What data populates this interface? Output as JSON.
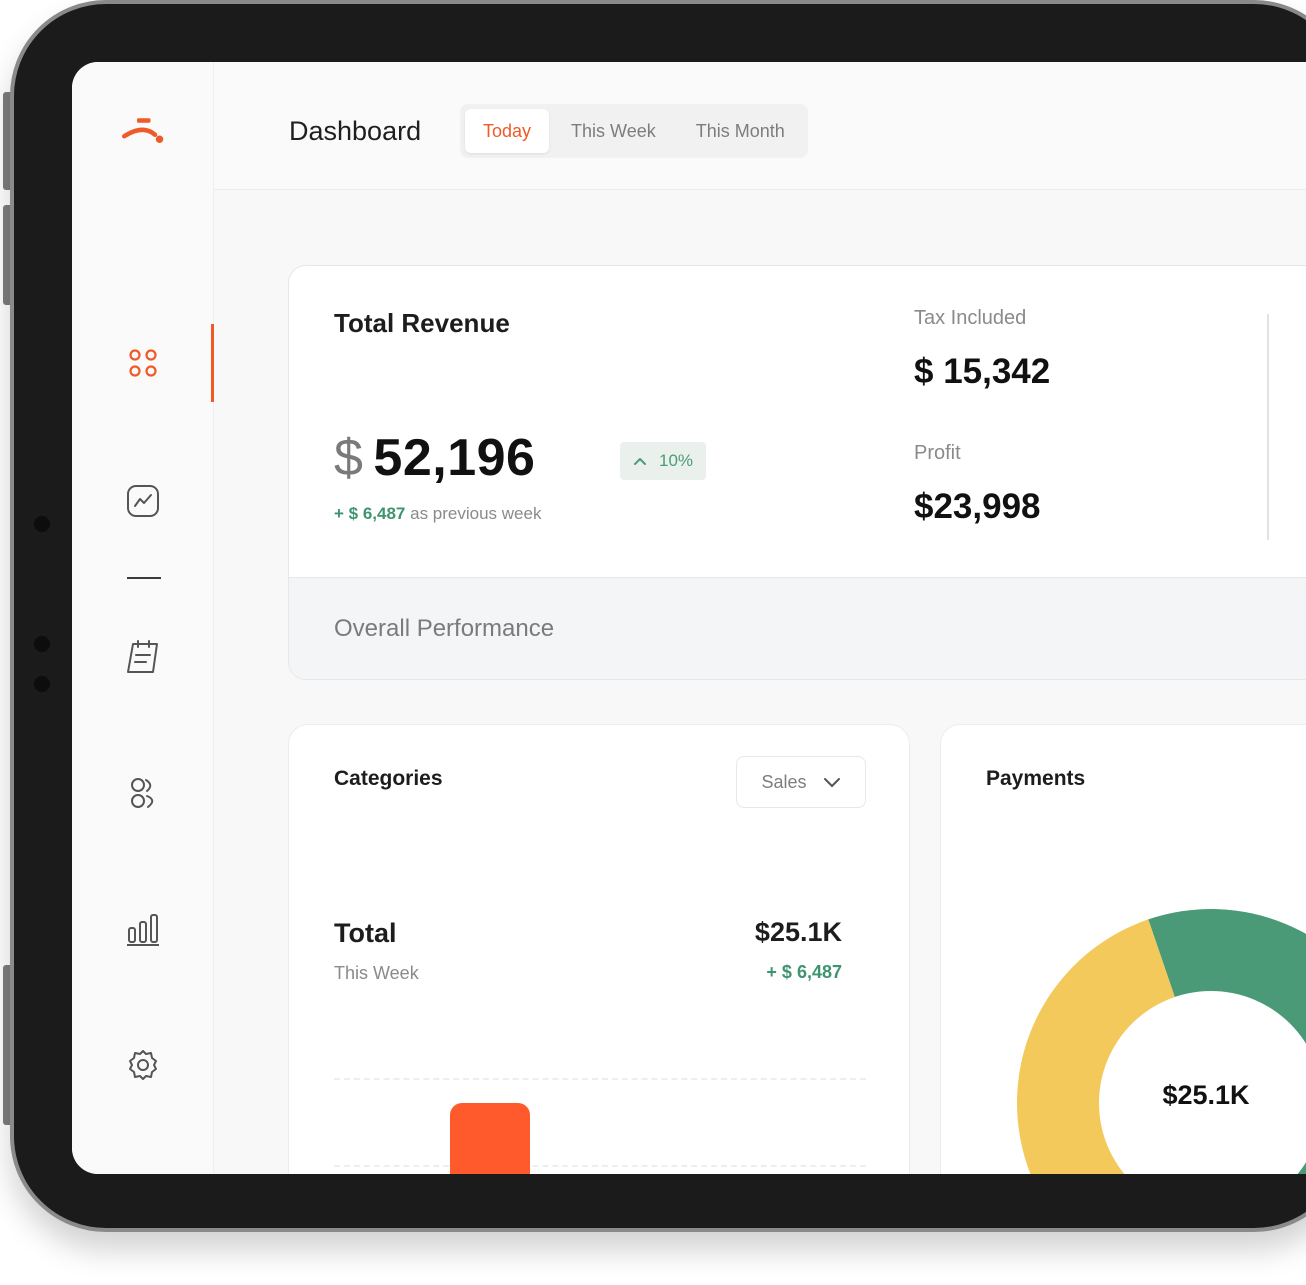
{
  "colors": {
    "accent": "#f05a28",
    "positive": "#3f9470",
    "donut_green": "#4a9a78",
    "donut_yellow": "#f2c95a",
    "bar": "#ff5a2c"
  },
  "sidebar": {
    "logo": "brand-logo",
    "items": [
      {
        "name": "dashboard",
        "icon": "four-dots-icon",
        "active": true
      },
      {
        "name": "analytics",
        "icon": "line-chart-icon",
        "active": false
      },
      {
        "name": "orders",
        "icon": "notepad-icon",
        "active": false
      },
      {
        "name": "customers",
        "icon": "users-icon",
        "active": false
      },
      {
        "name": "reports",
        "icon": "bar-chart-icon",
        "active": false
      },
      {
        "name": "settings",
        "icon": "gear-icon",
        "active": false
      }
    ]
  },
  "header": {
    "title": "Dashboard",
    "tabs": [
      {
        "label": "Today",
        "active": true
      },
      {
        "label": "This Week",
        "active": false
      },
      {
        "label": "This Month",
        "active": false
      }
    ]
  },
  "revenue": {
    "title": "Total Revenue",
    "currency": "$",
    "amount": "52,196",
    "change_badge": "10%",
    "previous_value": "+ $ 6,487",
    "previous_label": "as previous week",
    "tax_label": "Tax Included",
    "tax_value": "$ 15,342",
    "profit_label": "Profit",
    "profit_value": "$23,998",
    "footer_label": "Overall Performance"
  },
  "categories": {
    "title": "Categories",
    "select_value": "Sales",
    "total_label": "Total",
    "period_label": "This Week",
    "total_value": "$25.1K",
    "total_change": "+ $ 6,487"
  },
  "payments": {
    "title": "Payments",
    "center_value": "$25.1K",
    "slices": [
      {
        "color": "#4a9a78",
        "share": 0.69
      },
      {
        "color": "#f2c95a",
        "share": 0.31
      }
    ]
  }
}
